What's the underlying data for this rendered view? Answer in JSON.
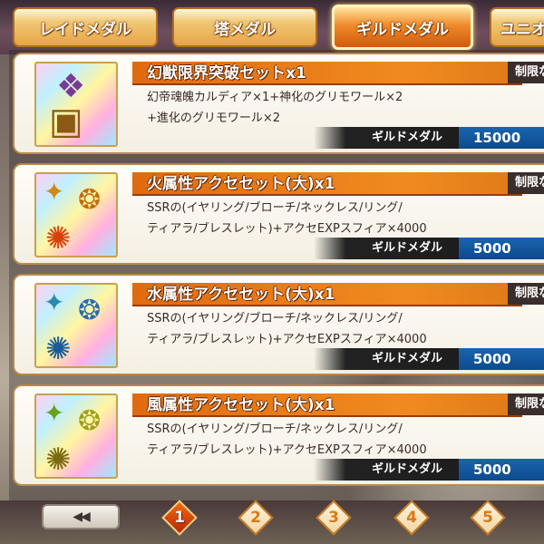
{
  "tabs": [
    {
      "label": "レイドメダル",
      "active": false
    },
    {
      "label": "塔メダル",
      "active": false
    },
    {
      "label": "ギルドメダル",
      "active": true
    },
    {
      "label": "ユニオ",
      "active": false
    }
  ],
  "items": [
    {
      "title": "幻獣限界突破セットx1",
      "limit": "制限な",
      "desc_lines": [
        "幻帝魂魄カルディア×1+神化のグリモワール×2",
        "+進化のグリモワール×2"
      ],
      "cost_label": "ギルドメダル",
      "cost_value": "15000",
      "icon": "treasure-chest-icon"
    },
    {
      "title": "火属性アクセセット(大)x1",
      "limit": "制限な",
      "desc_lines": [
        "SSRの(イヤリング/ブローチ/ネックレス/リング/",
        "ティアラ/ブレスレット)+アクセEXPスフィア×4000"
      ],
      "cost_label": "ギルドメダル",
      "cost_value": "5000",
      "icon": "fire-accessory-set-icon"
    },
    {
      "title": "水属性アクセセット(大)x1",
      "limit": "制限な",
      "desc_lines": [
        "SSRの(イヤリング/ブローチ/ネックレス/リング/",
        "ティアラ/ブレスレット)+アクセEXPスフィア×4000"
      ],
      "cost_label": "ギルドメダル",
      "cost_value": "5000",
      "icon": "water-accessory-set-icon"
    },
    {
      "title": "風属性アクセセット(大)x1",
      "limit": "制限な",
      "desc_lines": [
        "SSRの(イヤリング/ブローチ/ネックレス/リング/",
        "ティアラ/ブレスレット)+アクセEXPスフィア×4000"
      ],
      "cost_label": "ギルドメダル",
      "cost_value": "5000",
      "icon": "wind-accessory-set-icon"
    }
  ],
  "pager": {
    "prev_label": "◀◀",
    "pages": [
      "1",
      "2",
      "3",
      "4",
      "5"
    ],
    "current": "1"
  },
  "colors": {
    "accent": "#f08a20",
    "cost_blue": "#0d4a8c",
    "active_page": "#d0400c"
  }
}
